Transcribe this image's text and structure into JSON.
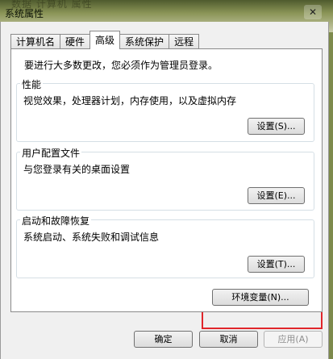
{
  "background": {
    "crumb_text": "数据   计算机   属性"
  },
  "window": {
    "title": "系统属性",
    "close_label": "✕"
  },
  "tabs": [
    {
      "label": "计算机名",
      "active": false
    },
    {
      "label": "硬件",
      "active": false
    },
    {
      "label": "高级",
      "active": true
    },
    {
      "label": "系统保护",
      "active": false
    },
    {
      "label": "远程",
      "active": false
    }
  ],
  "panel": {
    "admin_note": "要进行大多数更改，您必须作为管理员登录。",
    "groups": [
      {
        "title": "性能",
        "description": "视觉效果，处理器计划，内存使用，以及虚拟内存",
        "button": "设置(S)..."
      },
      {
        "title": "用户配置文件",
        "description": "与您登录有关的桌面设置",
        "button": "设置(E)..."
      },
      {
        "title": "启动和故障恢复",
        "description": "系统启动、系统失败和调试信息",
        "button": "设置(T)..."
      }
    ],
    "env_button": "环境变量(N)...",
    "env_highlight_color": "#e0262b"
  },
  "footer": {
    "ok": "确定",
    "cancel": "取消",
    "apply": "应用(A)"
  }
}
